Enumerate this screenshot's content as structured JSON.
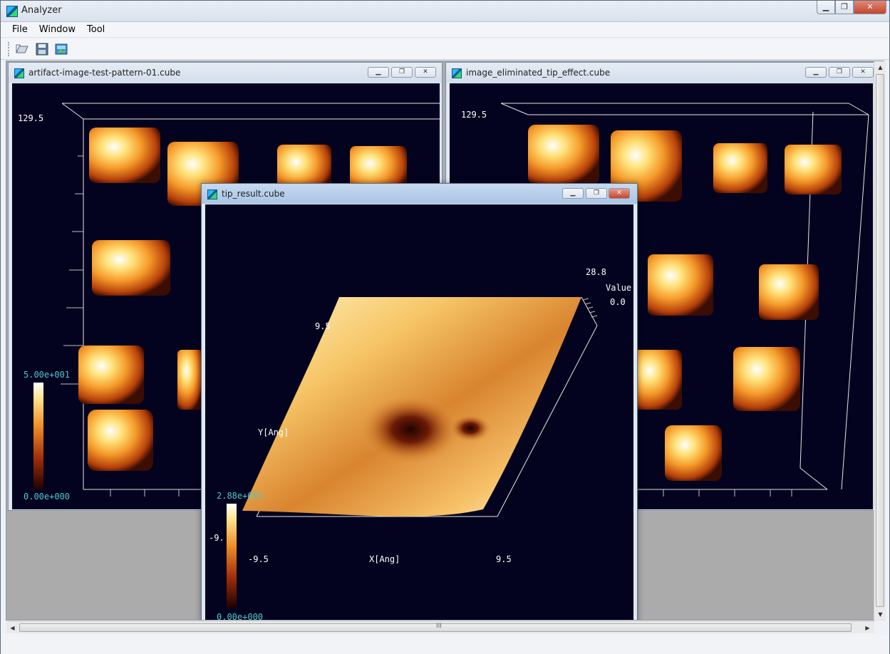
{
  "app": {
    "title": "Analyzer",
    "controls": {
      "minimize": "▁",
      "maximize": "❐",
      "close": "✕"
    }
  },
  "menu": [
    {
      "label": "File"
    },
    {
      "label": "Window"
    },
    {
      "label": "Tool"
    }
  ],
  "toolbar": {
    "open_icon": "folder-open-icon",
    "save_icon": "save-disk-icon",
    "image_icon": "image-export-icon"
  },
  "windows": {
    "left": {
      "title": "artifact-image-test-pattern-01.cube",
      "z_max": "129.5",
      "colorbar_max": "5.00e+001",
      "colorbar_min": "0.00e+000"
    },
    "right": {
      "title": "image_eliminated_tip_effect.cube",
      "z_max": "129.5"
    },
    "tip": {
      "title": "tip_result.cube",
      "value_max": "28.8",
      "value_label": "Value",
      "value_min": "0.0",
      "y_max": "9.5",
      "y_label": "Y[Ang]",
      "y_min": "-9.",
      "x_min": "-9.5",
      "x_label": "X[Ang]",
      "x_max": "9.5",
      "colorbar_max": "2.88e+001",
      "colorbar_min": "0.00e+000"
    }
  },
  "scrollbar": {
    "grip": "III"
  }
}
